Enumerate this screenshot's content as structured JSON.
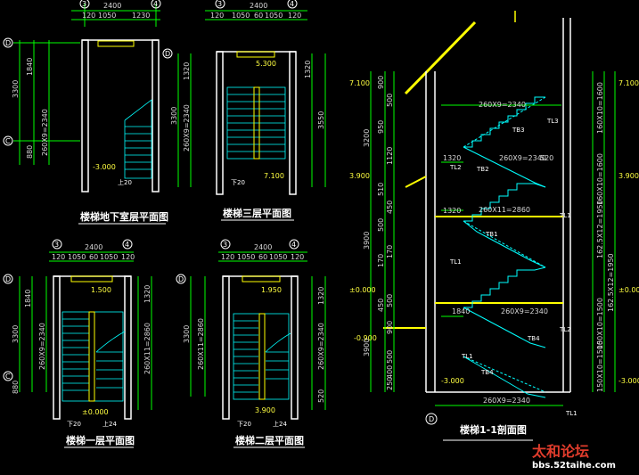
{
  "colors": {
    "background": "#000000",
    "wall": "#ffffff",
    "dim": "#00ff00",
    "stair": "#00ffff",
    "slab": "#ffff00",
    "text": "#d8d8d8"
  },
  "basement": {
    "title": "楼梯地下室层平面图",
    "axis_top": [
      "3",
      "4"
    ],
    "axis_left": [
      "D",
      "C"
    ],
    "top_total": "2400",
    "top_parts": [
      "120",
      "1050",
      "1230"
    ],
    "left_outer": "3300",
    "left_parts": [
      "1840",
      "880"
    ],
    "left_inner": "260X9=2340",
    "level": "-3.000",
    "up": "上20"
  },
  "third": {
    "title": "楼梯三层平面图",
    "axis_top": [
      "3",
      "4"
    ],
    "axis_left": [
      "D"
    ],
    "top_total": "2400",
    "top_parts": [
      "120",
      "1050",
      "60",
      "1050",
      "120"
    ],
    "left_parts": [
      "1320",
      "3300"
    ],
    "left_inner": "260X9=2340",
    "right_parts": [
      "1320",
      "3550"
    ],
    "level_top": "5.300",
    "level_bot": "7.100",
    "down": "下20",
    "small": "200"
  },
  "first": {
    "title": "楼梯一层平面图",
    "axis_top": [
      "3",
      "4"
    ],
    "axis_left": [
      "D",
      "C"
    ],
    "top_total": "2400",
    "top_parts": [
      "120",
      "1050",
      "60",
      "1050",
      "120"
    ],
    "left_outer": "3300",
    "left_parts": [
      "1840",
      "880"
    ],
    "left_inner": "260X9=2340",
    "right_parts": [
      "1320",
      "260X11=2860"
    ],
    "level_top": "1.500",
    "level_bot": "±0.000",
    "down": "下20",
    "up": "上24"
  },
  "second": {
    "title": "楼梯二层平面图",
    "axis_top": [
      "3",
      "4"
    ],
    "axis_left": [
      "D"
    ],
    "top_total": "2400",
    "top_parts": [
      "120",
      "1050",
      "60",
      "1050",
      "120"
    ],
    "left_outer": "3300",
    "left_inner": "260X11=2860",
    "right_parts": [
      "1320",
      "260X9=2340",
      "520"
    ],
    "level_top": "1.950",
    "level_bot": "3.900",
    "down": "下20",
    "up": "上24"
  },
  "section": {
    "title": "楼梯1-1剖面图",
    "axis_bottom": [
      "D"
    ],
    "levels": [
      "7.100",
      "3.900",
      "±0.000",
      "-0.900",
      "-3.000"
    ],
    "right_levels": [
      "7.100",
      "3.900",
      "±0.000",
      "-3.000"
    ],
    "left_dims": [
      "3200",
      "3900",
      "3900"
    ],
    "left_small": [
      "900",
      "950",
      "510",
      "500",
      "170",
      "450",
      "500",
      "1120",
      "450",
      "170",
      "500",
      "900",
      "500",
      "400",
      "250"
    ],
    "right_dims": [
      "160X10=1600",
      "160X10=1600",
      "162.5X12=1950",
      "162.5X12=1950",
      "150X10=1500",
      "150X10=1500"
    ],
    "flights": [
      "260X9=2340",
      "260X9=2340",
      "260X11=2860",
      "260X9=2340",
      "260X9=2340"
    ],
    "widths": [
      "1320",
      "1320",
      "1840",
      "520"
    ],
    "beams": [
      "TL3",
      "TL2",
      "TB3",
      "TB2",
      "TL1",
      "TB1",
      "TL1",
      "TL2",
      "TB4",
      "TL1",
      "TB4",
      "TL1"
    ]
  },
  "watermark": {
    "cn": "太和论坛",
    "url": "bbs.52taihe.com"
  }
}
